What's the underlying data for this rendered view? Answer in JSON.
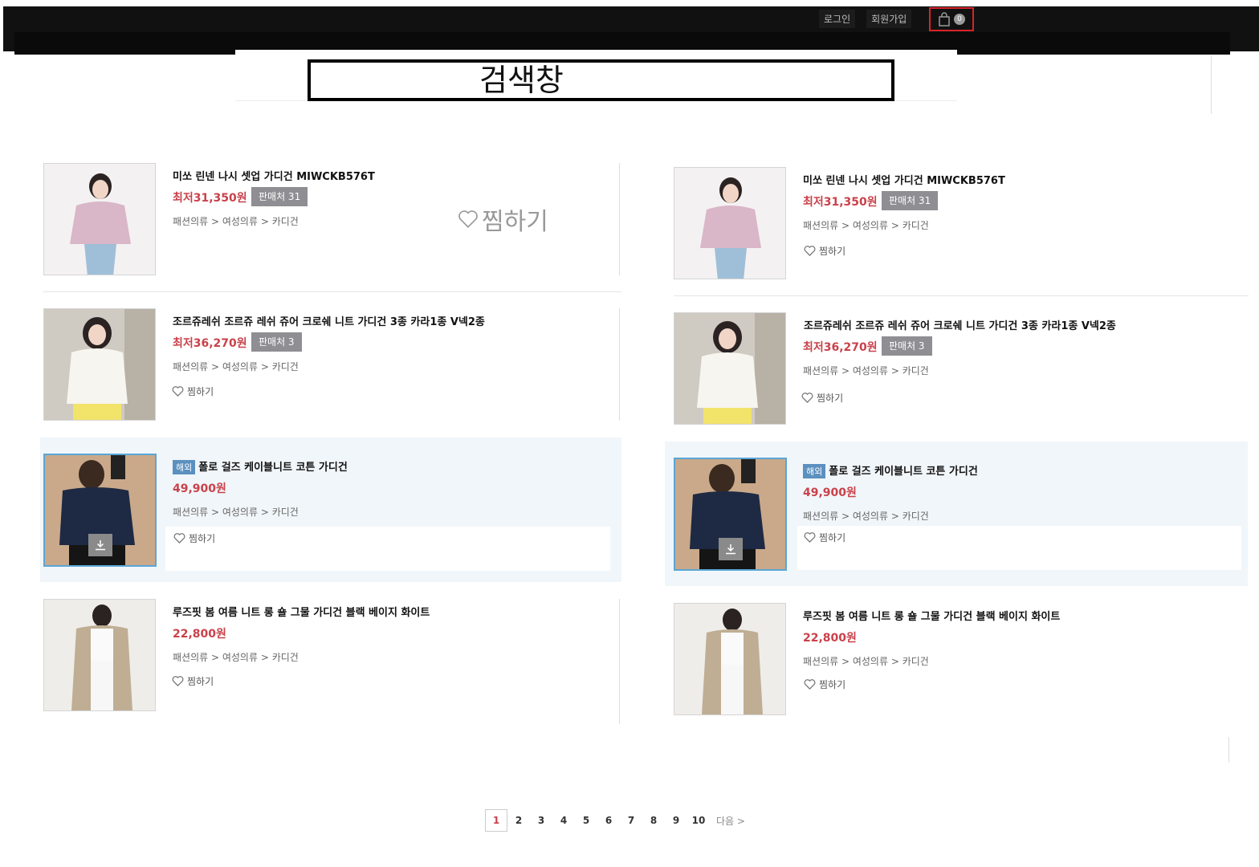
{
  "header": {
    "login_label": "로그인",
    "signup_label": "회원가입",
    "cart_count": "0"
  },
  "search": {
    "label": "검색창"
  },
  "products": [
    {
      "title": "미쏘 린넨 나시 셋업 가디건 MIWCKB576T",
      "price": "최저31,350원",
      "sellers": "판매처 31",
      "category": "패션의류 > 여성의류 > 카디건",
      "wish_label": "찜하기",
      "overseas": false
    },
    {
      "title": "조르쥬레쉬 조르쥬 레쉬 쥬어 크로쉐 니트 가디건 3종 카라1종 V넥2종",
      "price": "최저36,270원",
      "sellers": "판매처 3",
      "category": "패션의류 > 여성의류 > 카디건",
      "wish_label": "찜하기",
      "overseas": false
    },
    {
      "badge": "해외",
      "title": "폴로 걸즈 케이블니트 코튼 가디건",
      "price": "49,900원",
      "category": "패션의류 > 여성의류 > 카디건",
      "wish_label": "찜하기",
      "overseas": true
    },
    {
      "title": "루즈핏 봄 여름 니트 롱 숄 그물 가디건 블랙 베이지 화이트",
      "price": "22,800원",
      "category": "패션의류 > 여성의류 > 카디건",
      "wish_label": "찜하기",
      "overseas": false
    }
  ],
  "pagination": {
    "pages": [
      "1",
      "2",
      "3",
      "4",
      "5",
      "6",
      "7",
      "8",
      "9",
      "10"
    ],
    "current": "1",
    "next_label": "다음 >"
  },
  "colors": {
    "price": "#c9414a",
    "seller_badge": "#8e8e93",
    "overseas_badge": "#5b90bf",
    "overseas_bg": "#f1f6fa",
    "cart_highlight": "#d8232a"
  }
}
